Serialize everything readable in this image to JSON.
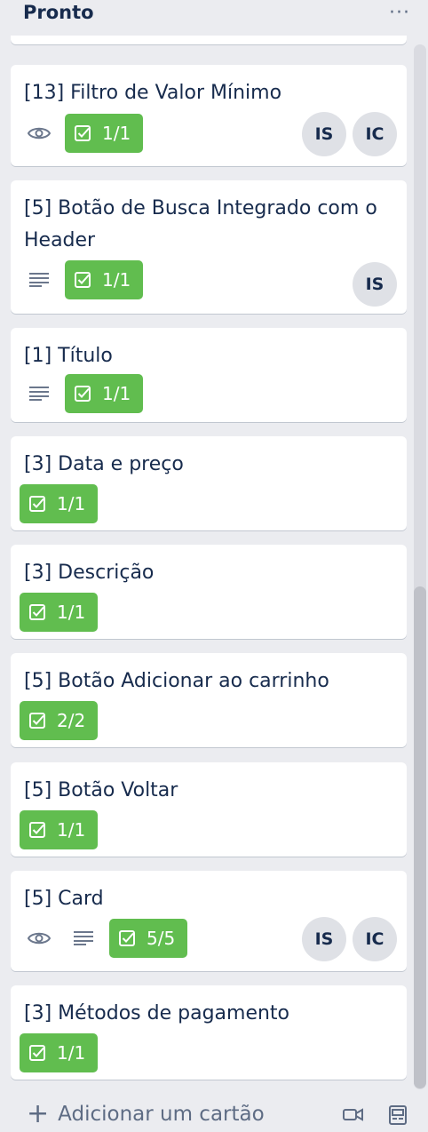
{
  "list": {
    "title": "Pronto",
    "menu_glyph": "···"
  },
  "cards": [
    {
      "title": "[13] Filtro de Valor Mínimo",
      "watching": true,
      "description": false,
      "checklist": "1/1",
      "members": [
        "IS",
        "IC"
      ]
    },
    {
      "title": "[5] Botão de Busca Integrado com o Header",
      "watching": false,
      "description": true,
      "checklist": "1/1",
      "members": [
        "IS"
      ]
    },
    {
      "title": "[1] Título",
      "watching": false,
      "description": true,
      "checklist": "1/1",
      "members": []
    },
    {
      "title": "[3] Data e preço",
      "watching": false,
      "description": false,
      "checklist": "1/1",
      "members": []
    },
    {
      "title": "[3] Descrição",
      "watching": false,
      "description": false,
      "checklist": "1/1",
      "members": []
    },
    {
      "title": "[5] Botão Adicionar ao carrinho",
      "watching": false,
      "description": false,
      "checklist": "2/2",
      "members": []
    },
    {
      "title": "[5] Botão Voltar",
      "watching": false,
      "description": false,
      "checklist": "1/1",
      "members": []
    },
    {
      "title": "[5] Card",
      "watching": true,
      "description": true,
      "checklist": "5/5",
      "members": [
        "IS",
        "IC"
      ]
    },
    {
      "title": "[3] Métodos de pagamento",
      "watching": false,
      "description": false,
      "checklist": "1/1",
      "members": []
    }
  ],
  "footer": {
    "add_card_label": "Adicionar um cartão",
    "icons": [
      "camera-icon",
      "card-template-icon"
    ]
  },
  "colors": {
    "background": "#ebecf0",
    "card": "#ffffff",
    "checklist_complete": "#61bd4f",
    "avatar": "#dfe1e6",
    "text": "#172b4d",
    "muted": "#5e6c84"
  }
}
